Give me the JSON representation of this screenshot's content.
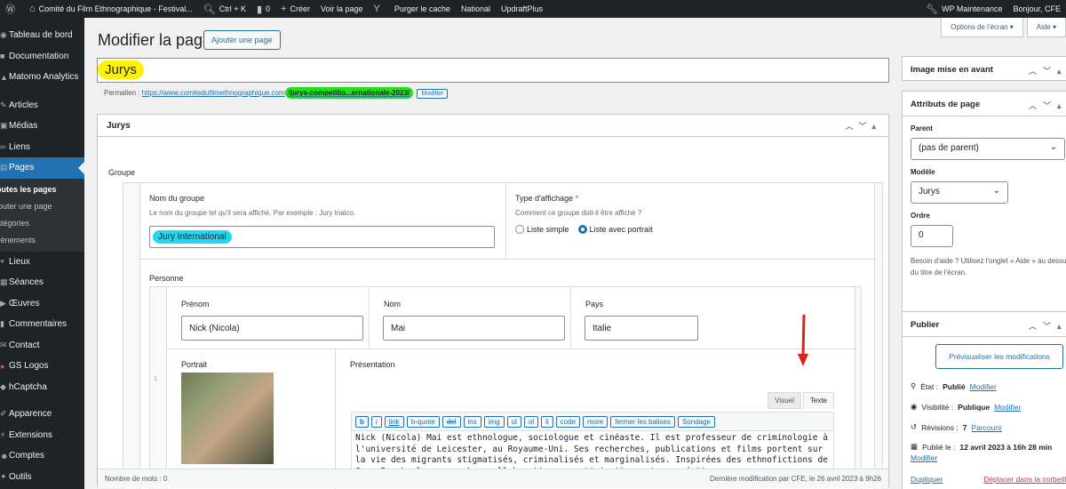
{
  "adminbar": {
    "site": "Comité du Film Ethnographique - Festival...",
    "search": "Ctrl + K",
    "comments": "0",
    "new": "Créer",
    "view": "Voir la page",
    "purge": "Purger le cache",
    "national": "National",
    "updraft": "UpdraftPlus",
    "maintenance": "WP Maintenance",
    "greeting": "Bonjour, CFE"
  },
  "sidebar": {
    "items_top": [
      {
        "label": "Tableau de bord",
        "icon": "dashboard-icon"
      },
      {
        "label": "Documentation",
        "icon": "book-icon"
      },
      {
        "label": "Matomo Analytics",
        "icon": "chart-icon"
      },
      {
        "label": "Articles",
        "icon": "pin-icon"
      },
      {
        "label": "Médias",
        "icon": "media-icon"
      },
      {
        "label": "Liens",
        "icon": "link-icon"
      },
      {
        "label": "Pages",
        "icon": "page-icon"
      }
    ],
    "sub": [
      "outes les pages",
      "jouter une page",
      "atégories",
      "vénements"
    ],
    "items_bottom": [
      {
        "label": "Lieux",
        "icon": "location-icon"
      },
      {
        "label": "Séances",
        "icon": "calendar-icon"
      },
      {
        "label": "Œuvres",
        "icon": "film-icon"
      },
      {
        "label": "Commentaires",
        "icon": "comment-icon"
      },
      {
        "label": "Contact",
        "icon": "mail-icon"
      },
      {
        "label": "GS Logos",
        "icon": "logo-icon"
      },
      {
        "label": "hCaptcha",
        "icon": "captcha-icon"
      },
      {
        "label": "Apparence",
        "icon": "brush-icon"
      },
      {
        "label": "Extensions",
        "icon": "plugin-icon"
      },
      {
        "label": "Comptes",
        "icon": "user-icon"
      },
      {
        "label": "Outils",
        "icon": "tools-icon"
      }
    ]
  },
  "header": {
    "title": "Modifier la page",
    "add_button": "Ajouter une page",
    "screen_options": "Options de l'écran",
    "help": "Aide"
  },
  "post": {
    "title": "Jurys",
    "permalink_label": "Permalien :",
    "permalink_base": "https://www.comitedufilmethnographique.com",
    "permalink_slug": "/jurys-competitio...ernationale-2023/",
    "modify": "Modifier"
  },
  "metabox": {
    "title": "Jurys",
    "group_label": "Groupe",
    "group_name_label": "Nom du groupe",
    "group_name_desc": "Le nom du groupe tel qu'il sera affiché. Par exemple : Jury Inalco.",
    "group_name_value": "Jury International",
    "display_label": "Type d'affichage",
    "display_required": "*",
    "display_desc": "Comment ce groupe doit-il être affiché ?",
    "options": [
      "Liste simple",
      "Liste avec portrait"
    ],
    "person_label": "Personne",
    "firstname_label": "Prénom",
    "firstname_value": "Nick (Nicola)",
    "lastname_label": "Nom",
    "lastname_value": "Mai",
    "country_label": "Pays",
    "country_value": "Italie",
    "portrait_label": "Portrait",
    "presentation_label": "Présentation",
    "row_number": "1",
    "tab_visual": "Visuel",
    "tab_text": "Texte",
    "quicktags": [
      "b",
      "i",
      "link",
      "b-quote",
      "del",
      "ins",
      "img",
      "ul",
      "ol",
      "li",
      "code",
      "more",
      "fermer les balises",
      "Sondage"
    ],
    "presentation_text": "Nick (Nicola) Mai est ethnologue, sociologue et cinéaste. Il est professeur de criminologie à l'université de Leicester, au Royaume-Uni. Ses recherches, publications et films portent sur la vie des migrants stigmatisés, criminalisés et marginalisés. Inspirées des ethnofictions de Jean Rouch, les approches collaboratives, participatives et co-créatives",
    "word_count": "Nombre de mots : 0",
    "last_modified": "Dernière modification par CFE, le 26 avril 2023 à 9h26"
  },
  "featured": {
    "title": "Image mise en avant"
  },
  "attributes": {
    "title": "Attributs de page",
    "parent_label": "Parent",
    "parent_value": "(pas de parent)",
    "template_label": "Modèle",
    "template_value": "Jurys",
    "order_label": "Ordre",
    "order_value": "0",
    "help": "Besoin d'aide ? Utilisez l'onglet « Aide » au dessus du titre de l'écran."
  },
  "publish": {
    "title": "Publier",
    "preview": "Prévisualiser les modifications",
    "state_label": "État :",
    "state_value": "Publié",
    "visibility_label": "Visibilité :",
    "visibility_value": "Publique",
    "revisions_label": "Révisions :",
    "revisions_value": "7",
    "browse": "Parcourir",
    "published_label": "Publié le :",
    "published_value": "12 avril 2023 à 16h 28 min",
    "modify": "Modifier",
    "duplicate": "Dupliquer",
    "trash": "Déplacer dans la corbeille"
  },
  "colors": {
    "accent": "#2271b1",
    "sidebar": "#1d2327",
    "highlight_yellow": "#fff200",
    "highlight_green": "#23e01a",
    "highlight_cyan": "#22d8f0",
    "arrow": "#e0201a"
  }
}
